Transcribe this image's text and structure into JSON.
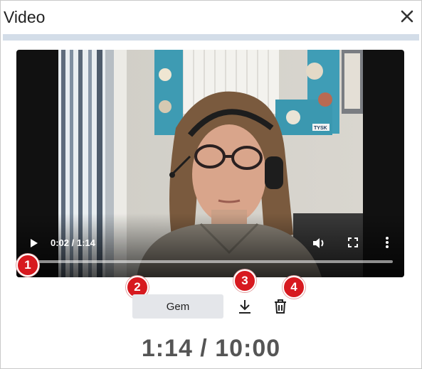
{
  "dialog": {
    "title": "Video",
    "close_icon": "close-icon"
  },
  "player": {
    "current_time": "0:02",
    "duration": "1:14",
    "time_readout": "0:02 / 1:14",
    "progress_fraction": 0.027,
    "icons": {
      "play": "play-icon",
      "volume": "volume-icon",
      "fullscreen": "fullscreen-icon",
      "more": "more-options-icon"
    },
    "poster_sign_text": "TYSK"
  },
  "actions": {
    "save_label": "Gem",
    "download_icon": "download-icon",
    "delete_icon": "trash-icon"
  },
  "callouts": [
    "1",
    "2",
    "3",
    "4"
  ],
  "recording": {
    "counter": "1:14 / 10:00"
  },
  "colors": {
    "badge": "#d7191f",
    "title_rule": "#d3dde8",
    "counter_text": "#555555"
  }
}
